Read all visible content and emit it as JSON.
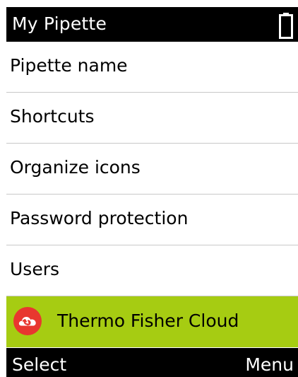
{
  "header": {
    "title": "My Pipette",
    "battery_icon": "battery-icon"
  },
  "menu": {
    "items": [
      {
        "label": "Pipette name"
      },
      {
        "label": "Shortcuts"
      },
      {
        "label": "Organize icons"
      },
      {
        "label": "Password protection"
      },
      {
        "label": "Users"
      },
      {
        "label": "Thermo Fisher Cloud",
        "icon": "cloud-icon",
        "selected": true
      }
    ]
  },
  "softkeys": {
    "left": "Select",
    "right": "Menu"
  },
  "colors": {
    "highlight": "#a6cc12",
    "cloud_badge": "#e8372f",
    "bars": "#000000"
  }
}
